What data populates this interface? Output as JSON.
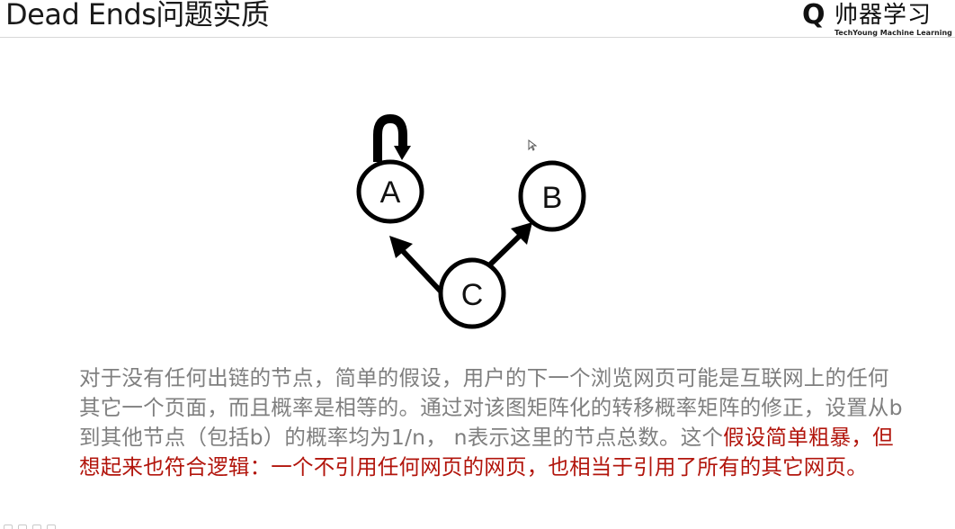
{
  "slide": {
    "title": "Dead Ends问题实质"
  },
  "brand": {
    "logo_letter": "Q",
    "name": "帅器学习",
    "tagline": "TechYoung Machine Learning Clas"
  },
  "graph": {
    "nodes": [
      {
        "id": "A",
        "label": "A"
      },
      {
        "id": "B",
        "label": "B"
      },
      {
        "id": "C",
        "label": "C"
      }
    ],
    "edges": [
      {
        "from": "C",
        "to": "A"
      },
      {
        "from": "C",
        "to": "B"
      },
      {
        "from": "A",
        "to": "A"
      }
    ]
  },
  "body": {
    "text_plain": "对于没有任何出链的节点，简单的假设，用户的下一个浏览网页可能是互联网上的任何其它一个页面，而且概率是相等的。通过对该图矩阵化的转移概率矩阵的修正，设置从b到其他节点（包括b）的概率均为1/n，  n表示这里的节点总数。这个",
    "text_emphasis": "假设简单粗暴，但想起来也符合逻辑：一个不引用任何网页的网页，也相当于引用了所有的其它网页。"
  },
  "colors": {
    "body_text": "#7f7f7f",
    "emphasis_text": "#b2150c",
    "title_text": "#1a1a1a",
    "graph_stroke": "#000000"
  }
}
